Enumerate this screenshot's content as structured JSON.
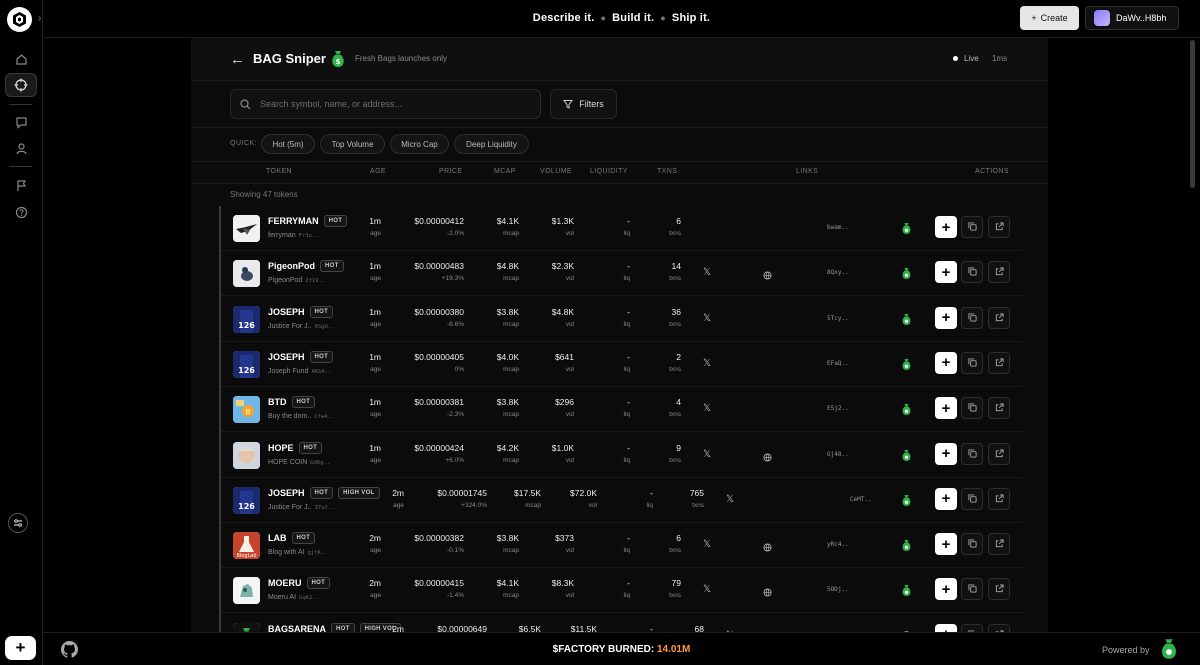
{
  "topbar": {
    "tagline": [
      "Describe it.",
      "Build it.",
      "Ship it."
    ],
    "create_label": "Create",
    "wallet_label": "DaWv..H8bh"
  },
  "header": {
    "title": "BAG Sniper",
    "subtitle": "Fresh Bags launches only",
    "live_label": "Live",
    "latency": "1ms"
  },
  "search": {
    "placeholder": "Search symbol, name, or address..."
  },
  "filters_label": "Filters",
  "quick": {
    "label": "QUICK:",
    "chips": [
      "Hot (5m)",
      "Top Volume",
      "Micro Cap",
      "Deep Liquidity"
    ]
  },
  "columns": [
    "TOKEN",
    "AGE",
    "PRICE",
    "MCAP",
    "VOLUME",
    "LIQUIDITY",
    "TXNS",
    "LINKS",
    "ACTIONS"
  ],
  "showing": "Showing 47 tokens",
  "units": {
    "age": "age",
    "mcap": "mcap",
    "vol": "vol",
    "liq": "liq",
    "txns": "txns"
  },
  "rows": [
    {
      "symbol": "FERRYMAN",
      "badges": [
        "HOT"
      ],
      "name": "ferryman",
      "addr": "Fr3u..",
      "age": "1m",
      "price": "$0.00000412",
      "change": "-2.0%",
      "mcap": "$4.1K",
      "volume": "$1.3K",
      "liq": "-",
      "txns": "6",
      "twitter": false,
      "web": false,
      "ca": "bwam..",
      "thumb": "bird"
    },
    {
      "symbol": "PigeonPod",
      "badges": [
        "HOT"
      ],
      "name": "PigeonPod",
      "addr": "2f1V..",
      "age": "1m",
      "price": "$0.00000483",
      "change": "+19.3%",
      "mcap": "$4.8K",
      "volume": "$2.3K",
      "liq": "-",
      "txns": "14",
      "twitter": true,
      "web": true,
      "ca": "8Qxy..",
      "thumb": "pigeon"
    },
    {
      "symbol": "JOSEPH",
      "badges": [
        "HOT"
      ],
      "name": "Justice For J..",
      "addr": "6SgU..",
      "age": "1m",
      "price": "$0.00000380",
      "change": "-8.6%",
      "mcap": "$3.8K",
      "volume": "$4.8K",
      "liq": "-",
      "txns": "36",
      "twitter": true,
      "web": false,
      "ca": "5Tcy..",
      "thumb": "jersey"
    },
    {
      "symbol": "JOSEPH",
      "badges": [
        "HOT"
      ],
      "name": "Joseph Fund",
      "addr": "AKbA..",
      "age": "1m",
      "price": "$0.00000405",
      "change": "0%",
      "mcap": "$4.0K",
      "volume": "$641",
      "liq": "-",
      "txns": "2",
      "twitter": true,
      "web": false,
      "ca": "EFaQ..",
      "thumb": "jersey"
    },
    {
      "symbol": "BTD",
      "badges": [
        "HOT"
      ],
      "name": "Buy the dom..",
      "addr": "Cfw4..",
      "age": "1m",
      "price": "$0.00000381",
      "change": "-2.3%",
      "mcap": "$3.8K",
      "volume": "$296",
      "liq": "-",
      "txns": "4",
      "twitter": true,
      "web": false,
      "ca": "E5j2..",
      "thumb": "btd"
    },
    {
      "symbol": "HOPE",
      "badges": [
        "HOT"
      ],
      "name": "HOPE COIN",
      "addr": "Gd6g..",
      "age": "1m",
      "price": "$0.00000424",
      "change": "+6.0%",
      "mcap": "$4.2K",
      "volume": "$1.0K",
      "liq": "-",
      "txns": "9",
      "twitter": true,
      "web": true,
      "ca": "Gj48..",
      "thumb": "face"
    },
    {
      "symbol": "JOSEPH",
      "badges": [
        "HOT",
        "HIGH VOL"
      ],
      "name": "Justice For J..",
      "addr": "37uf..",
      "age": "2m",
      "price": "$0.00001745",
      "change": "+324.0%",
      "mcap": "$17.5K",
      "volume": "$72.0K",
      "liq": "-",
      "txns": "765",
      "twitter": true,
      "web": false,
      "ca": "CeMT..",
      "thumb": "jersey"
    },
    {
      "symbol": "LAB",
      "badges": [
        "HOT"
      ],
      "name": "Blog with AI",
      "addr": "gjtK..",
      "age": "2m",
      "price": "$0.00000382",
      "change": "-0.1%",
      "mcap": "$3.8K",
      "volume": "$373",
      "liq": "-",
      "txns": "6",
      "twitter": true,
      "web": true,
      "ca": "yRc4..",
      "thumb": "lab"
    },
    {
      "symbol": "MOERU",
      "badges": [
        "HOT"
      ],
      "name": "Moeru AI",
      "addr": "GqA2..",
      "age": "2m",
      "price": "$0.00000415",
      "change": "-1.4%",
      "mcap": "$4.1K",
      "volume": "$8.3K",
      "liq": "-",
      "txns": "79",
      "twitter": true,
      "web": true,
      "ca": "5ODj..",
      "thumb": "moeru"
    },
    {
      "symbol": "BAGSARENA",
      "badges": [
        "HOT",
        "HIGH VOL"
      ],
      "name": "",
      "addr": "",
      "age": "2m",
      "price": "$0.00000649",
      "change": "",
      "mcap": "$6.5K",
      "volume": "$11.5K",
      "liq": "-",
      "txns": "68",
      "twitter": true,
      "web": true,
      "ca": "",
      "thumb": "bag"
    }
  ],
  "footer": {
    "burn_label": "$FACTORY BURNED:",
    "burn_value": "14.01M",
    "powered": "Powered by"
  },
  "colors": {
    "accent_green": "#2fb34a",
    "burn_orange": "#ff9a3d",
    "background": "#000000"
  }
}
